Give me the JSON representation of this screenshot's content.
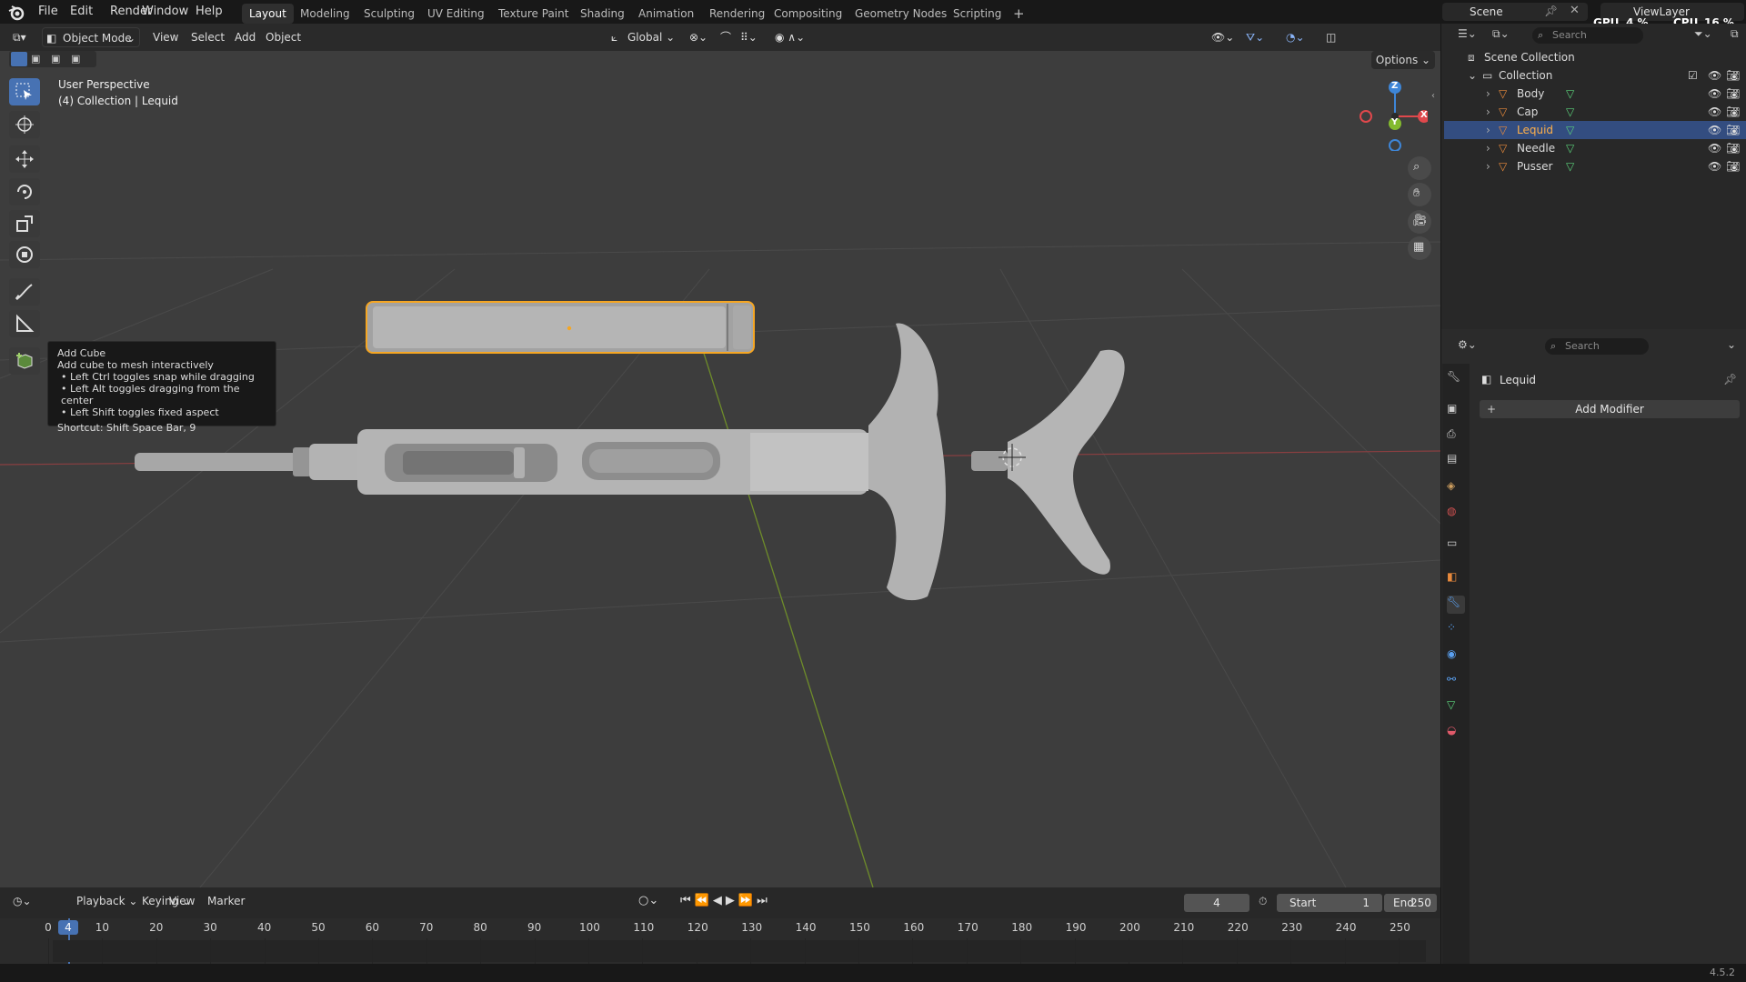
{
  "topbar": {
    "menus": [
      "File",
      "Edit",
      "Render",
      "Window",
      "Help"
    ],
    "workspaces": [
      "Layout",
      "Modeling",
      "Sculpting",
      "UV Editing",
      "Texture Paint",
      "Shading",
      "Animation",
      "Rendering",
      "Compositing",
      "Geometry Nodes",
      "Scripting"
    ],
    "active_workspace": "Layout",
    "add_tab": "+",
    "scene": "Scene",
    "view_layer": "ViewLayer",
    "gpu_label": "GPU",
    "gpu_value": "4 %",
    "cpu_label": "CPU",
    "cpu_value": "16 %"
  },
  "viewport_header": {
    "mode": "Object Mode",
    "menus": [
      "View",
      "Select",
      "Add",
      "Object"
    ],
    "transform_orientation": "Global",
    "options": "Options"
  },
  "viewport": {
    "perspective": "User Perspective",
    "collection_info": "(4) Collection | Lequid",
    "axis_x": "X",
    "axis_y": "Y",
    "axis_z": "Z"
  },
  "tooltip": {
    "title": "Add Cube",
    "description": "Add cube to mesh interactively",
    "bullets": [
      "Left Ctrl toggles snap while dragging",
      "Left Alt toggles dragging from the center",
      "Left Shift toggles fixed aspect"
    ],
    "shortcut": "Shortcut: Shift Space Bar, 9"
  },
  "timeline": {
    "menus": [
      "Playback",
      "Keying",
      "View",
      "Marker"
    ],
    "current_frame": "4",
    "start_label": "Start",
    "start_value": "1",
    "end_label": "End",
    "end_value": "250",
    "ticks": [
      "0",
      "4",
      "10",
      "20",
      "30",
      "40",
      "50",
      "60",
      "70",
      "80",
      "90",
      "100",
      "110",
      "120",
      "130",
      "140",
      "150",
      "160",
      "170",
      "180",
      "190",
      "200",
      "210",
      "220",
      "230",
      "240",
      "250"
    ]
  },
  "outliner": {
    "search_placeholder": "Search",
    "scene_collection": "Scene Collection",
    "collection": "Collection",
    "objects": [
      "Body",
      "Cap",
      "Lequid",
      "Needle",
      "Pusser"
    ],
    "selected": "Lequid"
  },
  "properties": {
    "search_placeholder": "Search",
    "object_name": "Lequid",
    "add_modifier": "Add Modifier"
  },
  "statusbar": {
    "version": "4.5.2"
  },
  "colors": {
    "accent": "#4772b3",
    "selection_orange": "#f5a623",
    "x_axis": "#e0484c",
    "y_axis": "#83ba2e",
    "z_axis": "#3e86d8"
  }
}
